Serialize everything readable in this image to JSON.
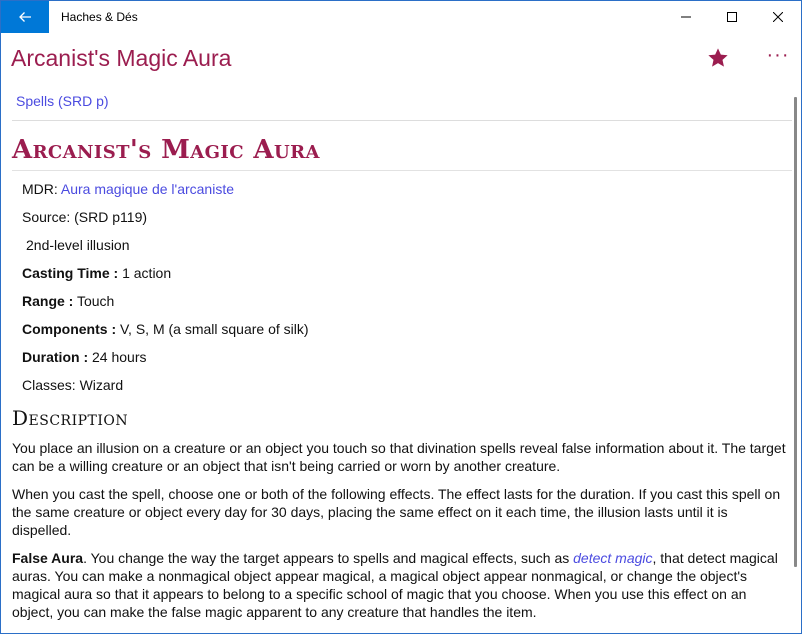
{
  "window": {
    "app_title": "Haches & Dés"
  },
  "header": {
    "title": "Arcanist's Magic Aura",
    "favorite_icon": "star-icon",
    "more_icon": "more-icon"
  },
  "breadcrumb": {
    "label": "Spells (SRD p)"
  },
  "spell": {
    "title": "Arcanist's Magic Aura",
    "mdr_label": "MDR: ",
    "mdr_link": "Aura magique de l'arcaniste",
    "source": "Source: (SRD p119)",
    "level_school": "2nd-level illusion",
    "casting_time_label": "Casting Time :",
    "casting_time": " 1 action",
    "range_label": "Range :",
    "range": " Touch",
    "components_label": "Components :",
    "components": " V, S, M (a small square of silk)",
    "duration_label": "Duration :",
    "duration": " 24 hours",
    "classes": "Classes: Wizard"
  },
  "description": {
    "heading": "Description",
    "p1": "You place an illusion on a creature or an object you touch so that divination spells reveal false information about it. The target can be a willing creature or an object that isn't being carried or worn by another creature.",
    "p2": "When you cast the spell, choose one or both of the following effects. The effect lasts for the duration. If you cast this spell on the same creature or object every day for 30 days, placing the same effect on it each time, the illusion lasts until it is dispelled.",
    "p3_bold": "False Aura",
    "p3_a": ". You change the way the target appears to spells and magical effects, such as ",
    "p3_link": "detect magic",
    "p3_b": ", that detect magical auras. You can make a nonmagical object appear magical, a magical object appear nonmagical, or change the object's magical aura so that it appears to belong to a specific school of magic that you choose. When you use this effect on an object, you can make the false magic apparent to any creature that handles the item."
  },
  "colors": {
    "accent": "#9b1d4f",
    "link": "#4b4be0",
    "titlebar_back": "#0078d7"
  }
}
